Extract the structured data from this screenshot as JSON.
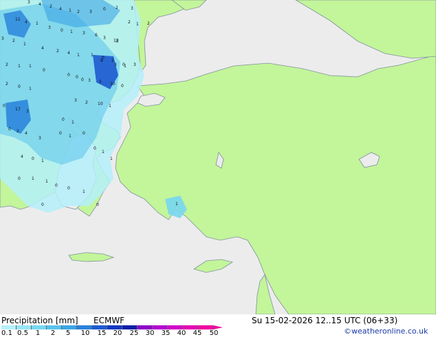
{
  "title": "Precipitation [mm]",
  "model": "ECMWF",
  "valid_time": "Su 15-02-2026 12..15 UTC (06+33)",
  "credit": "©weatheronline.co.uk",
  "legend": {
    "ticks": [
      "0.1",
      "0.5",
      "1",
      "2",
      "5",
      "10",
      "15",
      "20",
      "25",
      "30",
      "35",
      "40",
      "45",
      "50"
    ],
    "colors": [
      "#b4f0fa",
      "#96e6f5",
      "#78d7f0",
      "#5ac3eb",
      "#3ca5e6",
      "#2882dc",
      "#1e5ad2",
      "#1437c3",
      "#0a1eaa",
      "#8c00c8",
      "#b400d2",
      "#d200c8",
      "#e600b4",
      "#f000a0"
    ]
  },
  "colors": {
    "sea": "#ececec",
    "land": "#c3f59a",
    "border": "#7f8f9f",
    "precip_light": "#b4f0fa",
    "precip_med": "#5ac3eb",
    "precip_heavy": "#1e5ad2"
  },
  "map_values": [
    "3",
    "4",
    "2",
    "4",
    "1",
    "2",
    "3",
    "0",
    "2",
    "3",
    "11",
    "4",
    "1",
    "3",
    "0",
    "1",
    "3",
    "6",
    "3",
    "3",
    "2",
    "1",
    "2",
    "13",
    "3",
    "2",
    "1",
    "4",
    "2",
    "4",
    "1",
    "1",
    "0",
    "2",
    "0",
    "3",
    "2",
    "1",
    "1",
    "0",
    "8",
    "3",
    "1",
    "0",
    "0",
    "0",
    "3",
    "5",
    "10",
    "0",
    "2",
    "0",
    "1",
    "3",
    "2",
    "10",
    "1",
    "0",
    "17",
    "3",
    "0",
    "1",
    "0",
    "2",
    "4",
    "3",
    "0",
    "1",
    "0",
    "0",
    "1",
    "1",
    "4",
    "0",
    "1",
    "0",
    "1",
    "1",
    "0",
    "0",
    "1",
    "0",
    "0",
    "1"
  ]
}
